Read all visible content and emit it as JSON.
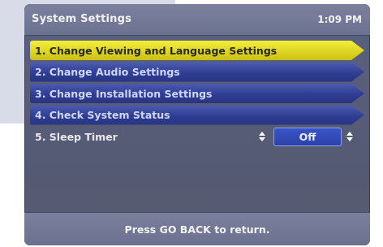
{
  "window": {
    "title": "System Settings",
    "time": "1:09 PM"
  },
  "menu": {
    "items": [
      {
        "label": "1.  Change Viewing and Language Settings",
        "state": "selected"
      },
      {
        "label": "2.  Change Audio Settings",
        "state": "normal"
      },
      {
        "label": "3.  Change Installation Settings",
        "state": "normal"
      },
      {
        "label": "4.  Check System Status",
        "state": "normal"
      }
    ],
    "sleep_timer": {
      "label": "5.  Sleep Timer",
      "value": "Off"
    }
  },
  "footer": {
    "hint": "Press GO BACK to return."
  },
  "colors": {
    "selected_bg": "#e6dd2a",
    "item_bg": "#2f3d92",
    "panel_bg": "#5a6180",
    "bar_bg": "#7b819d"
  }
}
